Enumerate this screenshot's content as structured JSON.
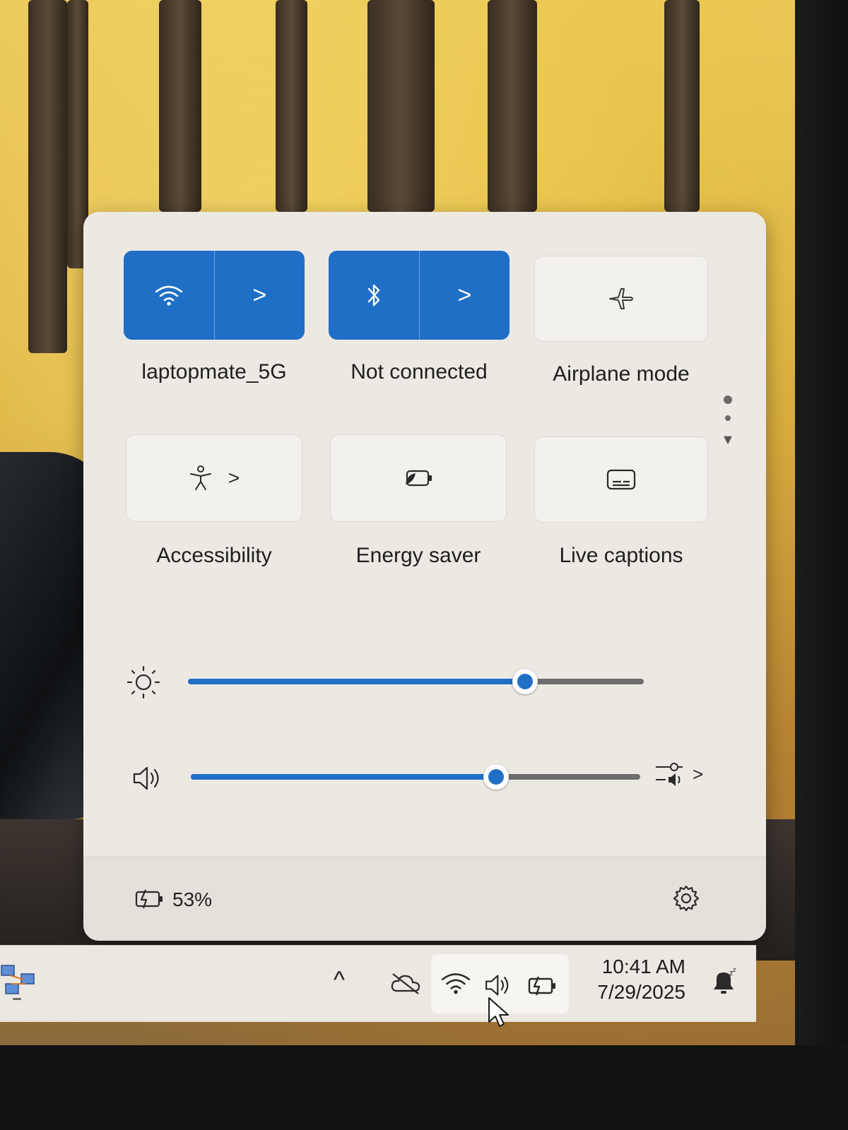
{
  "quick_settings": {
    "tiles_row1": [
      {
        "label": "laptopmate_5G",
        "icon": "wifi-icon",
        "state": "on",
        "has_chevron": true
      },
      {
        "label": "Not connected",
        "icon": "bluetooth-icon",
        "state": "on",
        "has_chevron": true
      },
      {
        "label": "Airplane mode",
        "icon": "airplane-icon",
        "state": "off",
        "has_chevron": false
      }
    ],
    "tiles_row2": [
      {
        "label": "Accessibility",
        "icon": "accessibility-icon",
        "state": "off",
        "has_chevron": true
      },
      {
        "label": "Energy saver",
        "icon": "energy-saver-icon",
        "state": "off",
        "has_chevron": false
      },
      {
        "label": "Live captions",
        "icon": "live-captions-icon",
        "state": "off",
        "has_chevron": false
      }
    ],
    "chevron_glyph": ">",
    "brightness": {
      "icon": "brightness-icon",
      "level_percent": 74
    },
    "volume": {
      "icon": "speaker-icon",
      "level_percent": 68
    },
    "battery_percent": "53%",
    "settings_icon": "gear-icon"
  },
  "taskbar": {
    "overflow_glyph": "^",
    "time": "10:41 AM",
    "date": "7/29/2025"
  },
  "colors": {
    "accent": "#1f6fc7",
    "panel_background": "#ece9e3",
    "tile_off_background": "#f3f1ed"
  }
}
